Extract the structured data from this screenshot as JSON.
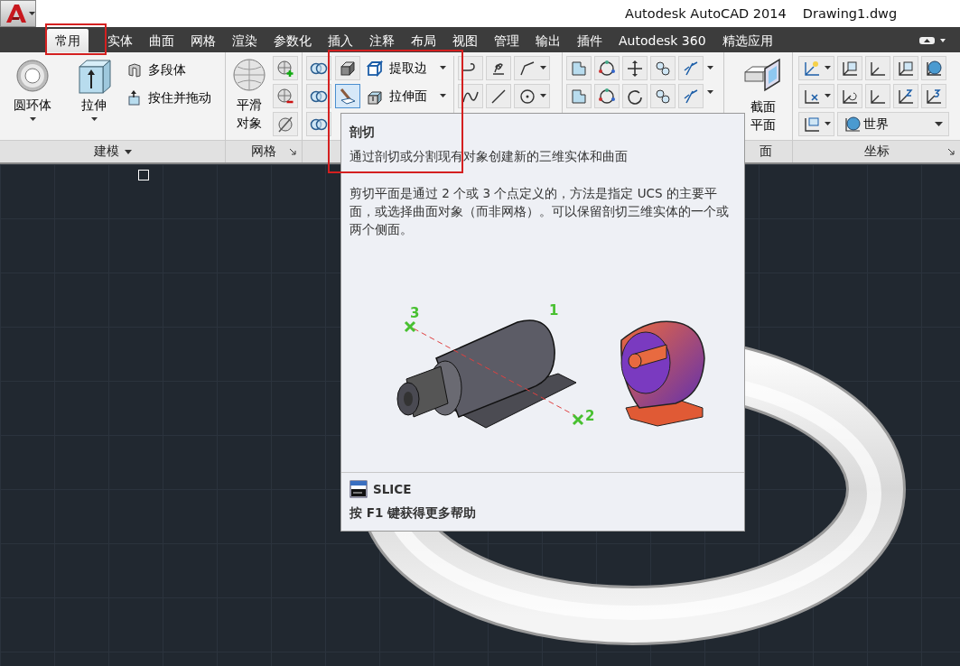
{
  "title_bar": {
    "app": "Autodesk AutoCAD 2014",
    "file": "Drawing1.dwg"
  },
  "tabs": [
    {
      "label": "常用",
      "selected": true
    },
    {
      "label": "实体",
      "selected": false
    },
    {
      "label": "曲面",
      "selected": false
    },
    {
      "label": "网格",
      "selected": false
    },
    {
      "label": "渲染",
      "selected": false
    },
    {
      "label": "参数化",
      "selected": false
    },
    {
      "label": "插入",
      "selected": false
    },
    {
      "label": "注释",
      "selected": false
    },
    {
      "label": "布局",
      "selected": false
    },
    {
      "label": "视图",
      "selected": false
    },
    {
      "label": "管理",
      "selected": false
    },
    {
      "label": "输出",
      "selected": false
    },
    {
      "label": "插件",
      "selected": false
    },
    {
      "label": "Autodesk 360",
      "selected": false
    },
    {
      "label": "精选应用",
      "selected": false
    }
  ],
  "modeling": {
    "title": "建模",
    "large_buttons": [
      "圆环体",
      "拉伸"
    ],
    "small_buttons": [
      "多段体",
      "按住并拖动"
    ]
  },
  "mesh": {
    "title": "网格",
    "large_button": [
      "平滑",
      "对象"
    ]
  },
  "solid_editing": {
    "small_buttons": [
      "提取边",
      "拉伸面"
    ]
  },
  "section": {
    "title": "面",
    "large_button": [
      "截面",
      "平面"
    ]
  },
  "coordinates": {
    "title": "坐标",
    "dropdown": "世界"
  },
  "tooltip": {
    "title": "剖切",
    "summary": "通过剖切或分割现有对象创建新的三维实体和曲面",
    "description": "剪切平面是通过 2 个或 3 个点定义的，方法是指定 UCS 的主要平面，或选择曲面对象（而非网格）。可以保留剖切三维实体的一个或两个侧面。",
    "point_labels": [
      "1",
      "2",
      "3"
    ],
    "command": "SLICE",
    "help": "按 F1 键获得更多帮助"
  }
}
